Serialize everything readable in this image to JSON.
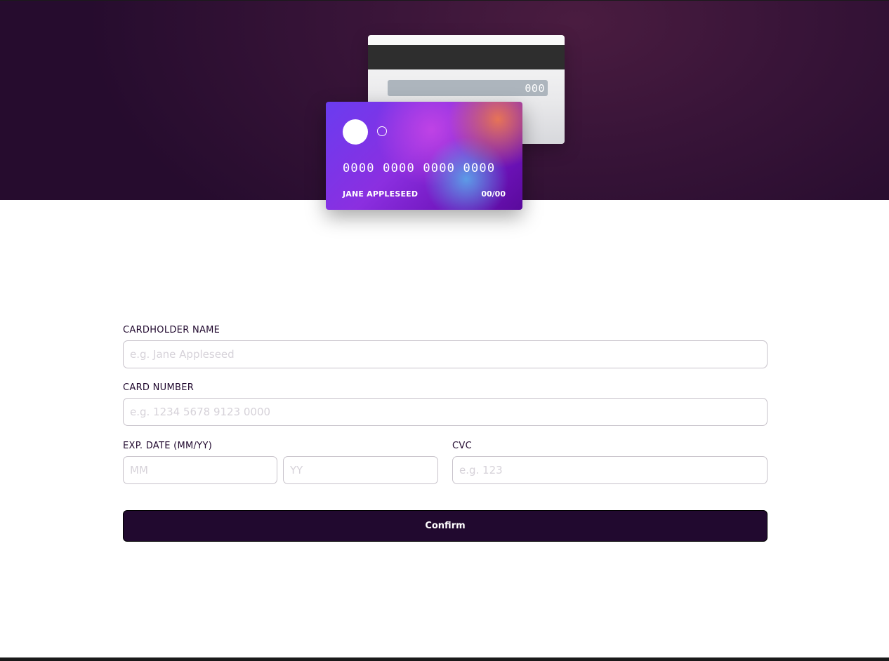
{
  "card_back": {
    "cvc": "000"
  },
  "card_front": {
    "number": "0000 0000 0000 0000",
    "holder": "JANE APPLESEED",
    "expiry": "00/00"
  },
  "form": {
    "cardholder": {
      "label": "CARDHOLDER NAME",
      "placeholder": "e.g. Jane Appleseed",
      "value": ""
    },
    "card_number": {
      "label": "CARD NUMBER",
      "placeholder": "e.g. 1234 5678 9123 0000",
      "value": ""
    },
    "exp_date": {
      "label": "EXP. DATE (MM/YY)",
      "month_placeholder": "MM",
      "year_placeholder": "YY"
    },
    "cvc": {
      "label": "CVC",
      "placeholder": "e.g. 123"
    },
    "confirm_label": "Confirm"
  },
  "colors": {
    "primary": "#21092f",
    "input_border": "#c8c3cb",
    "placeholder": "#d6d2d9",
    "hero_dark": "#260c2e"
  }
}
